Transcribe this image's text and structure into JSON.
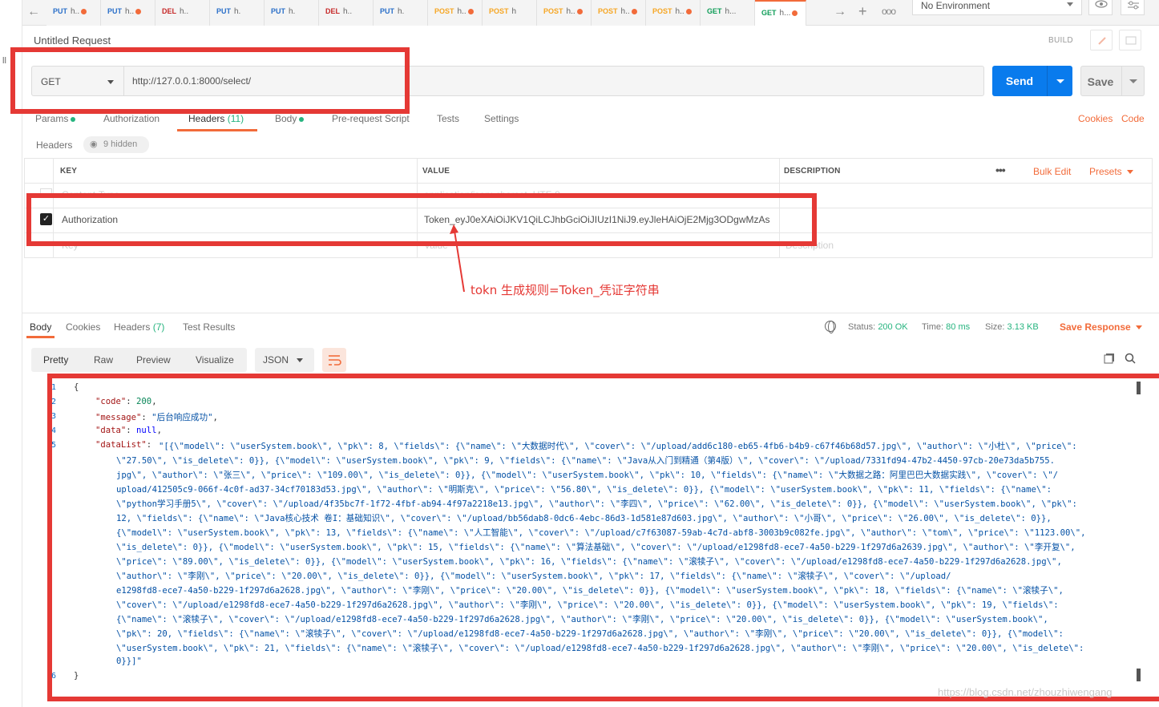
{
  "tabs": [
    {
      "method": "PUT",
      "title": "h..",
      "dot": true,
      "cls": "m-put"
    },
    {
      "method": "PUT",
      "title": "h..",
      "dot": true,
      "cls": "m-put"
    },
    {
      "method": "DEL",
      "title": "h..",
      "dot": false,
      "cls": "m-del"
    },
    {
      "method": "PUT",
      "title": "h.",
      "dot": false,
      "cls": "m-put"
    },
    {
      "method": "PUT",
      "title": "h.",
      "dot": false,
      "cls": "m-put"
    },
    {
      "method": "DEL",
      "title": "h..",
      "dot": false,
      "cls": "m-del"
    },
    {
      "method": "PUT",
      "title": "h.",
      "dot": false,
      "cls": "m-put"
    },
    {
      "method": "POST",
      "title": "h..",
      "dot": true,
      "cls": "m-post"
    },
    {
      "method": "POST",
      "title": "h",
      "dot": false,
      "cls": "m-post"
    },
    {
      "method": "POST",
      "title": "h..",
      "dot": true,
      "cls": "m-post"
    },
    {
      "method": "POST",
      "title": "h..",
      "dot": true,
      "cls": "m-post"
    },
    {
      "method": "POST",
      "title": "h..",
      "dot": true,
      "cls": "m-post"
    },
    {
      "method": "GET",
      "title": "h...",
      "dot": false,
      "cls": "m-get"
    },
    {
      "method": "GET",
      "title": "h...",
      "dot": true,
      "cls": "m-get",
      "active": true
    }
  ],
  "environment": "No Environment",
  "request": {
    "title": "Untitled Request",
    "build_label": "BUILD",
    "method": "GET",
    "url": "http://127.0.0.1:8000/select/",
    "send_label": "Send",
    "save_label": "Save"
  },
  "request_tabs": {
    "params": "Params",
    "authorization": "Authorization",
    "headers": "Headers",
    "headers_count": "(11)",
    "body": "Body",
    "prerequest": "Pre-request Script",
    "tests": "Tests",
    "settings": "Settings",
    "cookies": "Cookies",
    "code": "Code"
  },
  "headers_section": {
    "label": "Headers",
    "hidden": "9 hidden",
    "col_key": "KEY",
    "col_value": "VALUE",
    "col_description": "DESCRIPTION",
    "bulk_edit": "Bulk Edit",
    "presets": "Presets",
    "rows": [
      {
        "key": "Content-Type",
        "value": "application/json; charset=UTF-8"
      },
      {
        "key": "Authorization",
        "value": "Token_eyJ0eXAiOiJKV1QiLCJhbGciOiJIUzI1NiJ9.eyJleHAiOjE2Mjg3ODgwMzAs"
      }
    ],
    "placeholder_key": "Key",
    "placeholder_value": "Value",
    "placeholder_description": "Description"
  },
  "annotation": "tokn 生成规则=Token_凭证字符串",
  "response": {
    "tab_body": "Body",
    "tab_cookies": "Cookies",
    "tab_headers": "Headers",
    "tab_headers_count": "(7)",
    "tab_tests": "Test Results",
    "status_label": "Status:",
    "status_value": "200 OK",
    "time_label": "Time:",
    "time_value": "80 ms",
    "size_label": "Size:",
    "size_value": "3.13 KB",
    "save_response": "Save Response",
    "fmt_pretty": "Pretty",
    "fmt_raw": "Raw",
    "fmt_preview": "Preview",
    "fmt_visualize": "Visualize",
    "fmt_type": "JSON"
  },
  "code": {
    "line_numbers": [
      "1",
      "2",
      "3",
      "4",
      "5",
      "6"
    ],
    "open_brace": "{",
    "close_brace": "}",
    "code_key": "\"code\"",
    "code_val": "200",
    "message_key": "\"message\"",
    "message_val": "\"后台响应成功\"",
    "data_key": "\"data\"",
    "data_val": "null",
    "datalist_key": "\"dataList\"",
    "datalist_lines": [
      "\"[{\\\"model\\\": \\\"userSystem.book\\\", \\\"pk\\\": 8, \\\"fields\\\": {\\\"name\\\": \\\"大数据时代\\\", \\\"cover\\\": \\\"/upload/add6c180-eb65-4fb6-b4b9-c67f46b68d57.jpg\\\", \\\"author\\\": \\\"小杜\\\", \\\"price\\\":",
      "\\\"27.50\\\", \\\"is_delete\\\": 0}}, {\\\"model\\\": \\\"userSystem.book\\\", \\\"pk\\\": 9, \\\"fields\\\": {\\\"name\\\": \\\"Java从入门到精通（第4版）\\\", \\\"cover\\\": \\\"/upload/7331fd94-47b2-4450-97cb-20e73da5b755.",
      "jpg\\\", \\\"author\\\": \\\"张三\\\", \\\"price\\\": \\\"109.00\\\", \\\"is_delete\\\": 0}}, {\\\"model\\\": \\\"userSystem.book\\\", \\\"pk\\\": 10, \\\"fields\\\": {\\\"name\\\": \\\"大数据之路：阿里巴巴大数据实践\\\", \\\"cover\\\": \\\"/",
      "upload/412505c9-066f-4c0f-ad37-34cf70183d53.jpg\\\", \\\"author\\\": \\\"明斯克\\\", \\\"price\\\": \\\"56.80\\\", \\\"is_delete\\\": 0}}, {\\\"model\\\": \\\"userSystem.book\\\", \\\"pk\\\": 11, \\\"fields\\\": {\\\"name\\\":",
      "\\\"python学习手册5\\\", \\\"cover\\\": \\\"/upload/4f35bc7f-1f72-4fbf-ab94-4f97a2218e13.jpg\\\", \\\"author\\\": \\\"李四\\\", \\\"price\\\": \\\"62.00\\\", \\\"is_delete\\\": 0}}, {\\\"model\\\": \\\"userSystem.book\\\", \\\"pk\\\":",
      "12, \\\"fields\\\": {\\\"name\\\": \\\"Java核心技术 卷I：基础知识\\\", \\\"cover\\\": \\\"/upload/bb56dab8-0dc6-4ebc-86d3-1d581e87d603.jpg\\\", \\\"author\\\": \\\"小哥\\\", \\\"price\\\": \\\"26.00\\\", \\\"is_delete\\\": 0}},",
      "{\\\"model\\\": \\\"userSystem.book\\\", \\\"pk\\\": 13, \\\"fields\\\": {\\\"name\\\": \\\"人工智能\\\", \\\"cover\\\": \\\"/upload/c7f63087-59ab-4c7d-abf8-3003b9c082fe.jpg\\\", \\\"author\\\": \\\"tom\\\", \\\"price\\\": \\\"1123.00\\\",",
      "\\\"is_delete\\\": 0}}, {\\\"model\\\": \\\"userSystem.book\\\", \\\"pk\\\": 15, \\\"fields\\\": {\\\"name\\\": \\\"算法基础\\\", \\\"cover\\\": \\\"/upload/e1298fd8-ece7-4a50-b229-1f297d6a2639.jpg\\\", \\\"author\\\": \\\"李开复\\\",",
      "\\\"price\\\": \\\"89.00\\\", \\\"is_delete\\\": 0}}, {\\\"model\\\": \\\"userSystem.book\\\", \\\"pk\\\": 16, \\\"fields\\\": {\\\"name\\\": \\\"滚犊子\\\", \\\"cover\\\": \\\"/upload/e1298fd8-ece7-4a50-b229-1f297d6a2628.jpg\\\",",
      "\\\"author\\\": \\\"李刚\\\", \\\"price\\\": \\\"20.00\\\", \\\"is_delete\\\": 0}}, {\\\"model\\\": \\\"userSystem.book\\\", \\\"pk\\\": 17, \\\"fields\\\": {\\\"name\\\": \\\"滚犊子\\\", \\\"cover\\\": \\\"/upload/",
      "e1298fd8-ece7-4a50-b229-1f297d6a2628.jpg\\\", \\\"author\\\": \\\"李刚\\\", \\\"price\\\": \\\"20.00\\\", \\\"is_delete\\\": 0}}, {\\\"model\\\": \\\"userSystem.book\\\", \\\"pk\\\": 18, \\\"fields\\\": {\\\"name\\\": \\\"滚犊子\\\",",
      "\\\"cover\\\": \\\"/upload/e1298fd8-ece7-4a50-b229-1f297d6a2628.jpg\\\", \\\"author\\\": \\\"李刚\\\", \\\"price\\\": \\\"20.00\\\", \\\"is_delete\\\": 0}}, {\\\"model\\\": \\\"userSystem.book\\\", \\\"pk\\\": 19, \\\"fields\\\":",
      "{\\\"name\\\": \\\"滚犊子\\\", \\\"cover\\\": \\\"/upload/e1298fd8-ece7-4a50-b229-1f297d6a2628.jpg\\\", \\\"author\\\": \\\"李刚\\\", \\\"price\\\": \\\"20.00\\\", \\\"is_delete\\\": 0}}, {\\\"model\\\": \\\"userSystem.book\\\",",
      "\\\"pk\\\": 20, \\\"fields\\\": {\\\"name\\\": \\\"滚犊子\\\", \\\"cover\\\": \\\"/upload/e1298fd8-ece7-4a50-b229-1f297d6a2628.jpg\\\", \\\"author\\\": \\\"李刚\\\", \\\"price\\\": \\\"20.00\\\", \\\"is_delete\\\": 0}}, {\\\"model\\\":",
      "\\\"userSystem.book\\\", \\\"pk\\\": 21, \\\"fields\\\": {\\\"name\\\": \\\"滚犊子\\\", \\\"cover\\\": \\\"/upload/e1298fd8-ece7-4a50-b229-1f297d6a2628.jpg\\\", \\\"author\\\": \\\"李刚\\\", \\\"price\\\": \\\"20.00\\\", \\\"is_delete\\\":",
      "0}}]\""
    ]
  },
  "watermark": "https://blog.csdn.net/zhouzhiwengang",
  "colors": {
    "accent": "#f26b3a",
    "send": "#097bed",
    "annotation": "#e53935",
    "success": "#26b47f"
  }
}
